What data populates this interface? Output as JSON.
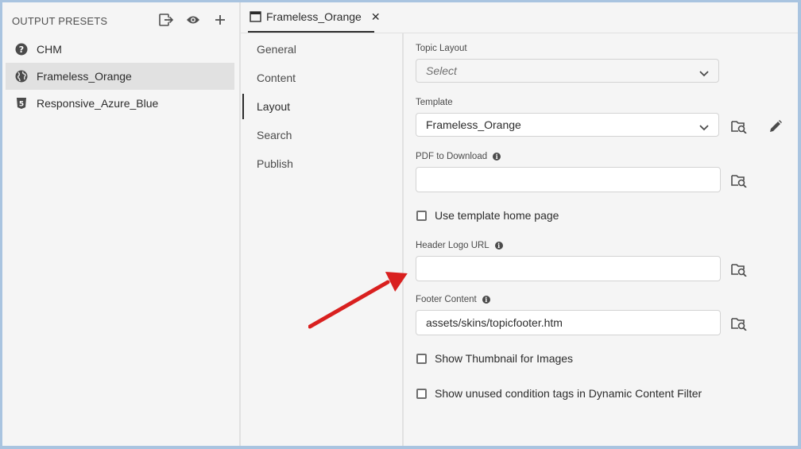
{
  "left_panel": {
    "title": "OUTPUT PRESETS",
    "icons": [
      "export-icon",
      "eye-icon",
      "plus-icon"
    ],
    "presets": [
      {
        "label": "CHM",
        "icon": "help-circle-icon",
        "selected": false
      },
      {
        "label": "Frameless_Orange",
        "icon": "globe-icon",
        "selected": true
      },
      {
        "label": "Responsive_Azure_Blue",
        "icon": "html5-icon",
        "selected": false
      }
    ]
  },
  "tab": {
    "label": "Frameless_Orange",
    "close": "✕"
  },
  "categories": [
    "General",
    "Content",
    "Layout",
    "Search",
    "Publish"
  ],
  "active_category": "Layout",
  "form": {
    "topic_layout": {
      "label": "Topic Layout",
      "placeholder": "Select"
    },
    "template": {
      "label": "Template",
      "value": "Frameless_Orange"
    },
    "pdf_download": {
      "label": "PDF to Download",
      "value": ""
    },
    "use_home_page": {
      "label": "Use template home page",
      "checked": false
    },
    "header_logo": {
      "label": "Header Logo URL",
      "value": ""
    },
    "footer_content": {
      "label": "Footer Content",
      "value": "assets/skins/topicfooter.htm"
    },
    "show_thumbnail": {
      "label": "Show Thumbnail for Images",
      "checked": false
    },
    "show_unused": {
      "label": "Show unused condition tags in Dynamic Content Filter",
      "checked": false
    }
  },
  "colors": {
    "arrow": "#d9201f",
    "selected_bg": "#e1e1e1",
    "frame_border": "#a9c4e0"
  }
}
